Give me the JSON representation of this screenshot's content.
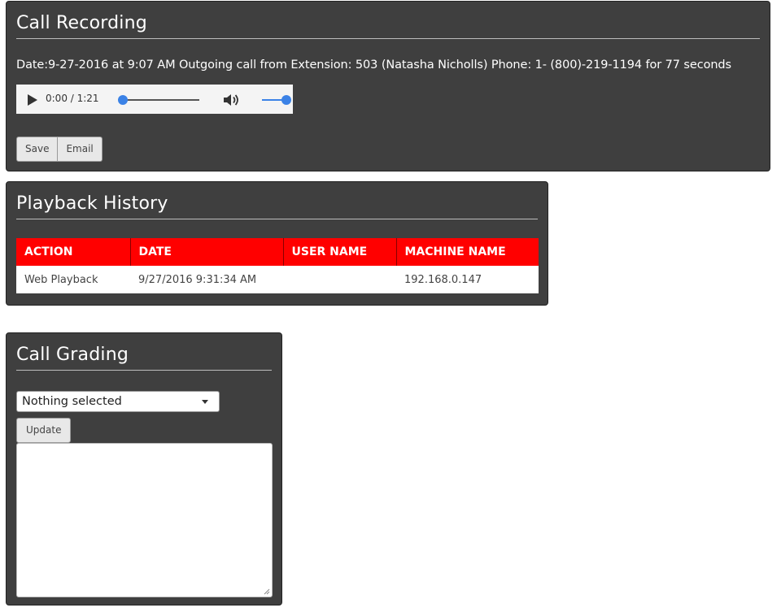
{
  "call_recording": {
    "title": "Call Recording",
    "info": "Date:9-27-2016 at 9:07 AM Outgoing call from Extension: 503 (Natasha Nicholls) Phone: 1- (800)-219-1194 for 77 seconds",
    "player": {
      "time": "0:00 / 1:21",
      "progress": 0,
      "volume": 1.0,
      "play_icon": "play-icon",
      "volume_icon": "volume-icon"
    },
    "buttons": {
      "save": "Save",
      "email": "Email"
    }
  },
  "playback_history": {
    "title": "Playback History",
    "columns": [
      "ACTION",
      "DATE",
      "USER NAME",
      "MACHINE NAME"
    ],
    "rows": [
      [
        "Web Playback",
        "9/27/2016 9:31:34 AM",
        "",
        "192.168.0.147"
      ]
    ],
    "header_color": "#ff0000"
  },
  "call_grading": {
    "title": "Call Grading",
    "select_value": "Nothing selected",
    "update_label": "Update",
    "notes_value": ""
  },
  "colors": {
    "panel_bg": "#3f3f3f",
    "accent": "#3b82e6",
    "table_header": "#ff0000"
  }
}
